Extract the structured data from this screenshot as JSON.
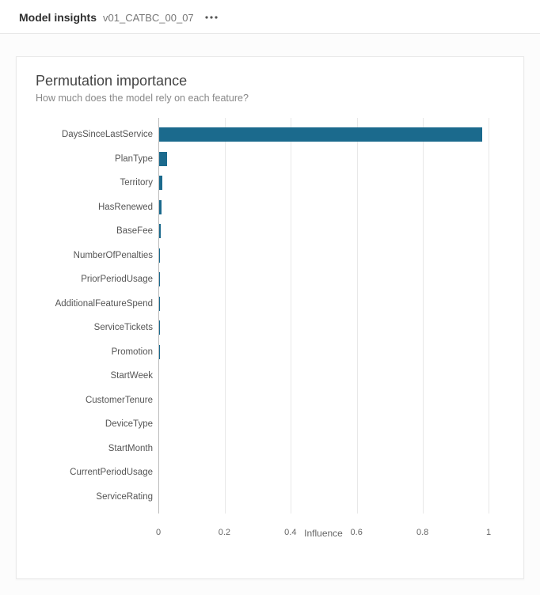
{
  "header": {
    "title": "Model insights",
    "subtitle": "v01_CATBC_00_07",
    "menu_icon": "more-horizontal"
  },
  "card": {
    "title": "Permutation importance",
    "subtitle": "How much does the model rely on each feature?"
  },
  "chart_data": {
    "type": "bar",
    "orientation": "horizontal",
    "categories": [
      "DaysSinceLastService",
      "PlanType",
      "Territory",
      "HasRenewed",
      "BaseFee",
      "NumberOfPenalties",
      "PriorPeriodUsage",
      "AdditionalFeatureSpend",
      "ServiceTickets",
      "Promotion",
      "StartWeek",
      "CustomerTenure",
      "DeviceType",
      "StartMonth",
      "CurrentPeriodUsage",
      "ServiceRating"
    ],
    "values": [
      0.98,
      0.025,
      0.01,
      0.008,
      0.005,
      0.002,
      0.002,
      0.001,
      0.001,
      0.001,
      0.0,
      0.0,
      0.0,
      0.0,
      0.0,
      0.0
    ],
    "xlabel": "Influence",
    "ylabel": "",
    "xlim": [
      0,
      1
    ],
    "x_ticks": [
      0,
      0.2,
      0.4,
      0.6,
      0.8,
      1
    ],
    "bar_color": "#1b6a8d",
    "grid": true
  }
}
